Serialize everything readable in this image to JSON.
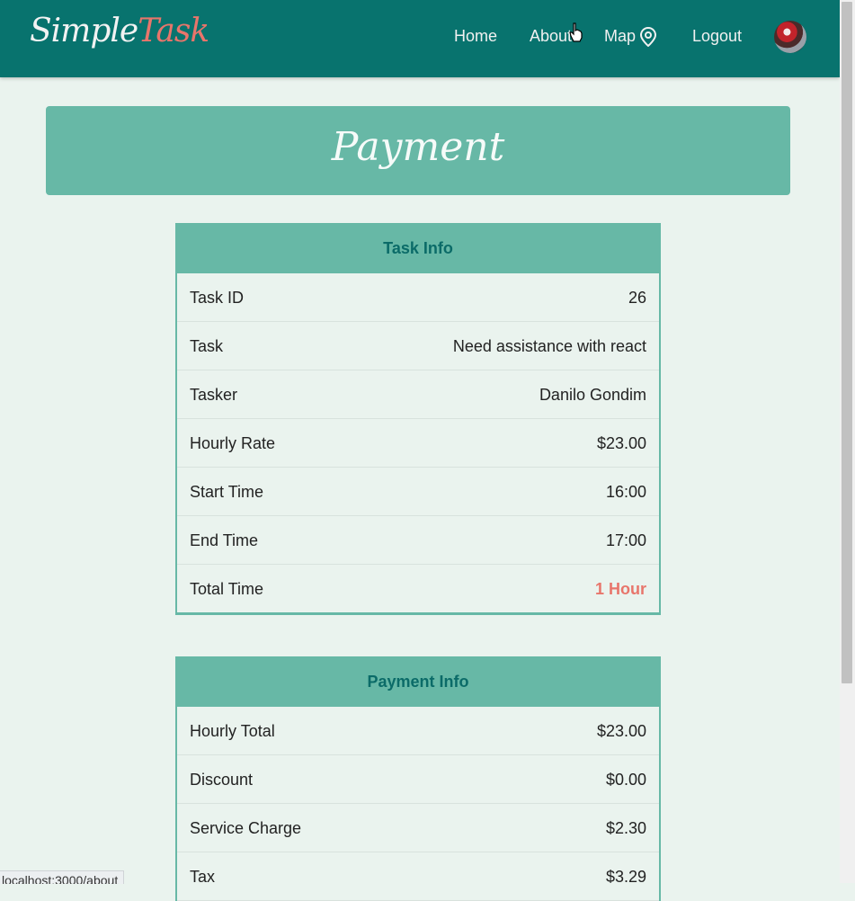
{
  "brand": {
    "part1": "Simple",
    "part2": "Task"
  },
  "nav": {
    "home": "Home",
    "about": "About",
    "map": "Map",
    "logout": "Logout"
  },
  "page_title": "Payment",
  "task_info": {
    "heading": "Task Info",
    "rows": [
      {
        "label": "Task ID",
        "value": "26"
      },
      {
        "label": "Task",
        "value": "Need assistance with react"
      },
      {
        "label": "Tasker",
        "value": "Danilo Gondim"
      },
      {
        "label": "Hourly Rate",
        "value": "$23.00"
      },
      {
        "label": "Start Time",
        "value": "16:00"
      },
      {
        "label": "End Time",
        "value": "17:00"
      },
      {
        "label": "Total Time",
        "value": "1 Hour"
      }
    ]
  },
  "payment_info": {
    "heading": "Payment Info",
    "rows": [
      {
        "label": "Hourly Total",
        "value": "$23.00"
      },
      {
        "label": "Discount",
        "value": "$0.00"
      },
      {
        "label": "Service Charge",
        "value": "$2.30"
      },
      {
        "label": "Tax",
        "value": "$3.29"
      }
    ]
  },
  "status_bar": {
    "url": "localhost:3000/about"
  },
  "colors": {
    "navbar": "#08736e",
    "accent": "#67b8a6",
    "highlight": "#e8756b",
    "background": "#eaf3ee"
  }
}
